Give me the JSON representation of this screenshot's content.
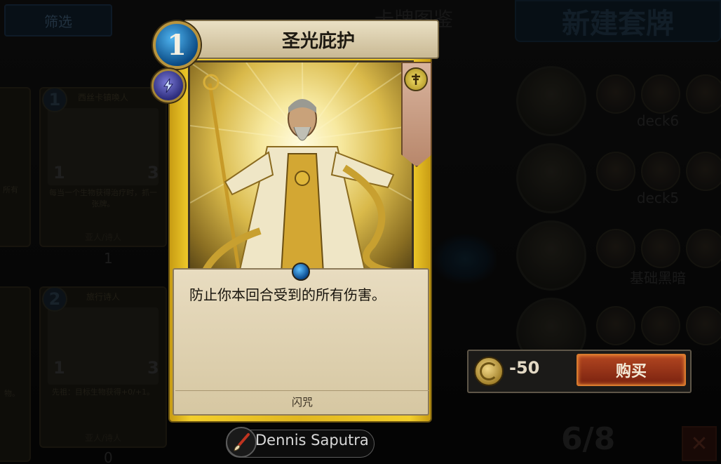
{
  "top_bar": {
    "filter_label": "筛选",
    "collection_label": "卡牌图鉴",
    "new_deck_label": "新建套牌"
  },
  "background_cards": [
    {
      "name": "西丝卡镇唤人",
      "cost": "1",
      "attack": "1",
      "health": "3",
      "text": "每当一个生物获得治疗时，抓一张牌。",
      "type": "亚人/诗人",
      "count": "1"
    },
    {
      "name": "旅行诗人",
      "cost": "2",
      "attack": "1",
      "health": "3",
      "text": "先祖：目标生物获得+0/+1。",
      "type": "亚人/诗人",
      "count": "0"
    }
  ],
  "left_partial": {
    "text_top": "所有",
    "text_bottom": "物。"
  },
  "decks": [
    {
      "name": "deck6"
    },
    {
      "name": "deck5"
    },
    {
      "name": "基础黑暗"
    },
    {
      "name": ""
    }
  ],
  "deck_count": "6/8",
  "card": {
    "name": "圣光庇护",
    "cost": "1",
    "rules_text": "防止你本回合受到的所有伤害。",
    "type": "闪咒",
    "artist": "Dennis Saputra",
    "colors": {
      "frame": "#e1b720",
      "cost_orb": "#0b4c86"
    }
  },
  "purchase": {
    "price": "-50",
    "buy_label": "购买"
  },
  "icons": [
    "coin-icon",
    "brush-icon",
    "lightning-icon",
    "faction-icon",
    "close-icon"
  ]
}
